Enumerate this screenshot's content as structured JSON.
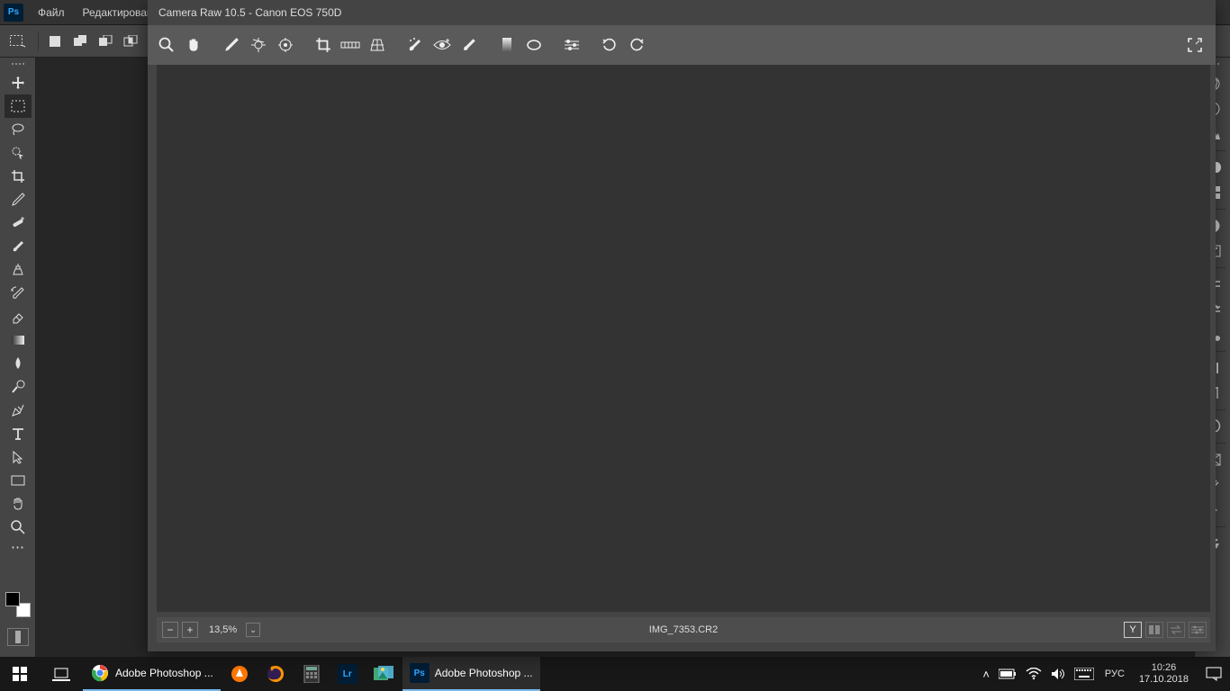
{
  "menubar": {
    "file": "Файл",
    "edit": "Редактировани"
  },
  "camera_raw": {
    "title": "Camera Raw 10.5  -  Canon EOS 750D",
    "zoom": "13,5%",
    "filename": "IMG_7353.CR2",
    "clip_shadow": "Y"
  },
  "taskbar": {
    "chrome_label": "Adobe Photoshop ...",
    "ps_label": "Adobe Photoshop ...",
    "lang": "РУС",
    "time": "10:26",
    "date": "17.10.2018"
  }
}
